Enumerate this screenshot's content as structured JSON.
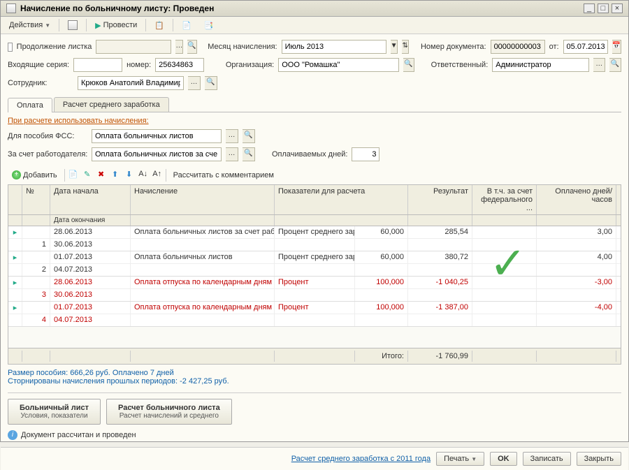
{
  "title": "Начисление по больничному листу: Проведен",
  "toolbar": {
    "actions": "Действия",
    "process": "Провести"
  },
  "header": {
    "continuation_label": "Продолжение листка",
    "month_label": "Месяц начисления:",
    "month_value": "Июль 2013",
    "docnum_label": "Номер документа:",
    "docnum_value": "00000000003",
    "from_label": "от:",
    "from_value": "05.07.2013",
    "incoming_series_label": "Входящие серия:",
    "incoming_series_value": "",
    "incoming_num_label": "номер:",
    "incoming_num_value": "25634863",
    "org_label": "Организация:",
    "org_value": "ООО \"Ромашка\"",
    "responsible_label": "Ответственный:",
    "responsible_value": "Администратор",
    "employee_label": "Сотрудник:",
    "employee_value": "Крюков Анатолий Владимирс"
  },
  "tabs": {
    "payment": "Оплата",
    "avg": "Расчет среднего заработка"
  },
  "section": {
    "title": "При расчете использовать начисления:",
    "fss_label": "Для пособия ФСС:",
    "fss_value": "Оплата больничных листов",
    "employer_label": "За счет работодателя:",
    "employer_value": "Оплата больничных листов за сче",
    "paid_days_label": "Оплачиваемых дней:",
    "paid_days_value": "3"
  },
  "tbl_toolbar": {
    "add": "Добавить",
    "calc_comment": "Рассчитать с комментарием"
  },
  "grid": {
    "headers": {
      "num": "№",
      "date_start": "Дата начала",
      "date_end": "Дата окончания",
      "calc": "Начисление",
      "indicators": "Показатели для расчета",
      "result": "Результат",
      "federal": "В т.ч. за счет федерального ...",
      "days": "Оплачено дней/часов"
    },
    "rows": [
      {
        "n": "1",
        "red": false,
        "d1": "28.06.2013",
        "d2": "30.06.2013",
        "calc": "Оплата больничных листов за счет работодателя",
        "ind": "Процент среднего заработка",
        "indv": "60,000",
        "res": "285,54",
        "fed": "",
        "days": "3,00"
      },
      {
        "n": "2",
        "red": false,
        "d1": "01.07.2013",
        "d2": "04.07.2013",
        "calc": "Оплата больничных листов",
        "ind": "Процент среднего заработка",
        "indv": "60,000",
        "res": "380,72",
        "fed": "",
        "days": "4,00"
      },
      {
        "n": "3",
        "red": true,
        "d1": "28.06.2013",
        "d2": "30.06.2013",
        "calc": "Оплата отпуска по календарным дням",
        "ind": "Процент",
        "indv": "100,000",
        "res": "-1 040,25",
        "fed": "",
        "days": "-3,00"
      },
      {
        "n": "4",
        "red": true,
        "d1": "01.07.2013",
        "d2": "04.07.2013",
        "calc": "Оплата отпуска по календарным дням",
        "ind": "Процент",
        "indv": "100,000",
        "res": "-1 387,00",
        "fed": "",
        "days": "-4,00"
      }
    ],
    "total_label": "Итого:",
    "total_value": "-1 760,99"
  },
  "summary": {
    "line1": "Размер пособия: 666,26 руб. Оплачено 7 дней",
    "line2": "Сторнированы начисления прошлых периодов: -2 427,25 руб."
  },
  "panels": {
    "bl_main": "Больничный лист",
    "bl_sub": "Условия, показатели",
    "calc_main": "Расчет больничного листа",
    "calc_sub": "Расчет начислений и среднего"
  },
  "status": "Документ рассчитан и проведен",
  "footer": {
    "hint": "Расчет среднего заработка с 2011 года",
    "print": "Печать",
    "ok": "OK",
    "save": "Записать",
    "close": "Закрыть"
  }
}
